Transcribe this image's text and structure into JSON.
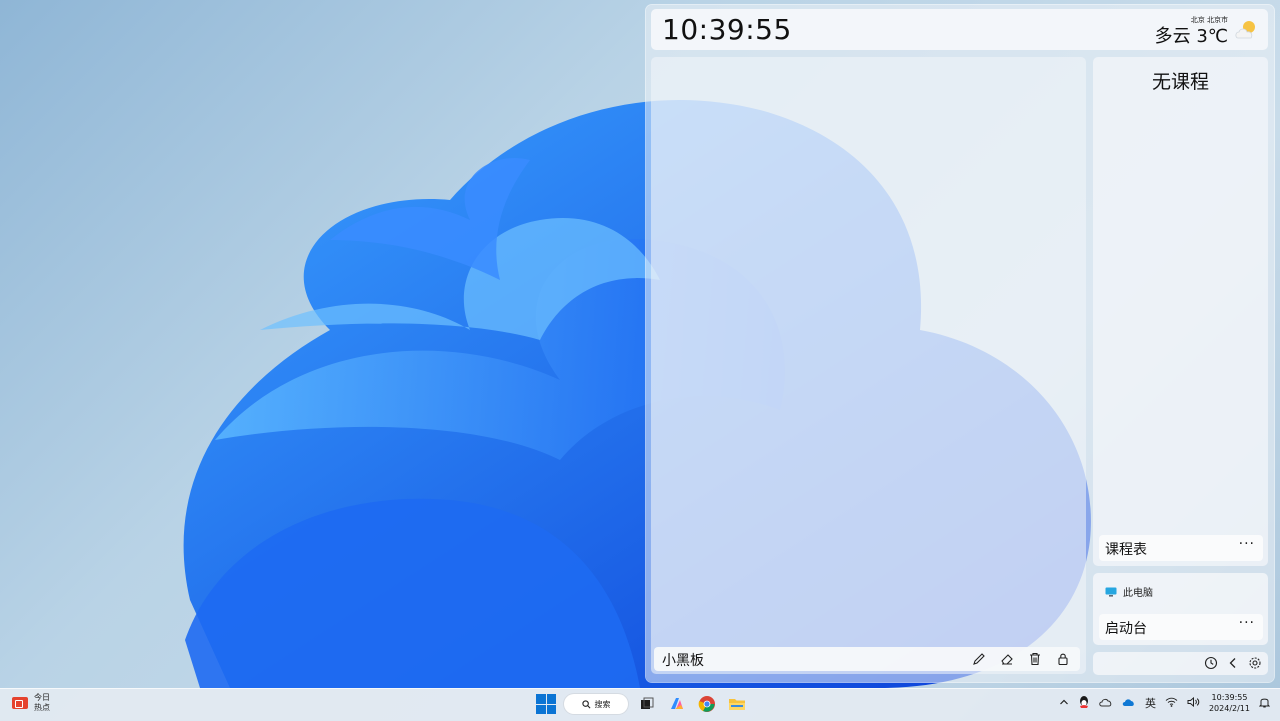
{
  "widgets": {
    "clock": {
      "time": "10:39:55"
    },
    "weather": {
      "location": "北京 北京市",
      "summary": "多云 3℃",
      "icon": "partly-cloudy-icon"
    },
    "blackboard": {
      "title": "小黑板",
      "tools": [
        "pencil-icon",
        "eraser-icon",
        "trash-icon",
        "lock-icon"
      ]
    },
    "course": {
      "empty_text": "无课程",
      "bar_label": "课程表",
      "more": "···"
    },
    "launcher": {
      "item_label": "此电脑",
      "bar_label": "启动台",
      "more": "···"
    },
    "controls": {
      "icons": [
        "clock-icon",
        "chevron-left-icon",
        "gear-icon"
      ]
    }
  },
  "taskbar": {
    "news": {
      "line1": "今日",
      "line2": "热点"
    },
    "search_label": "搜索",
    "ime": "英",
    "tray_time": "10:39:55",
    "tray_date": "2024/2/11"
  },
  "colors": {
    "accent": "#0b74d4",
    "news_badge": "#e5432f"
  }
}
